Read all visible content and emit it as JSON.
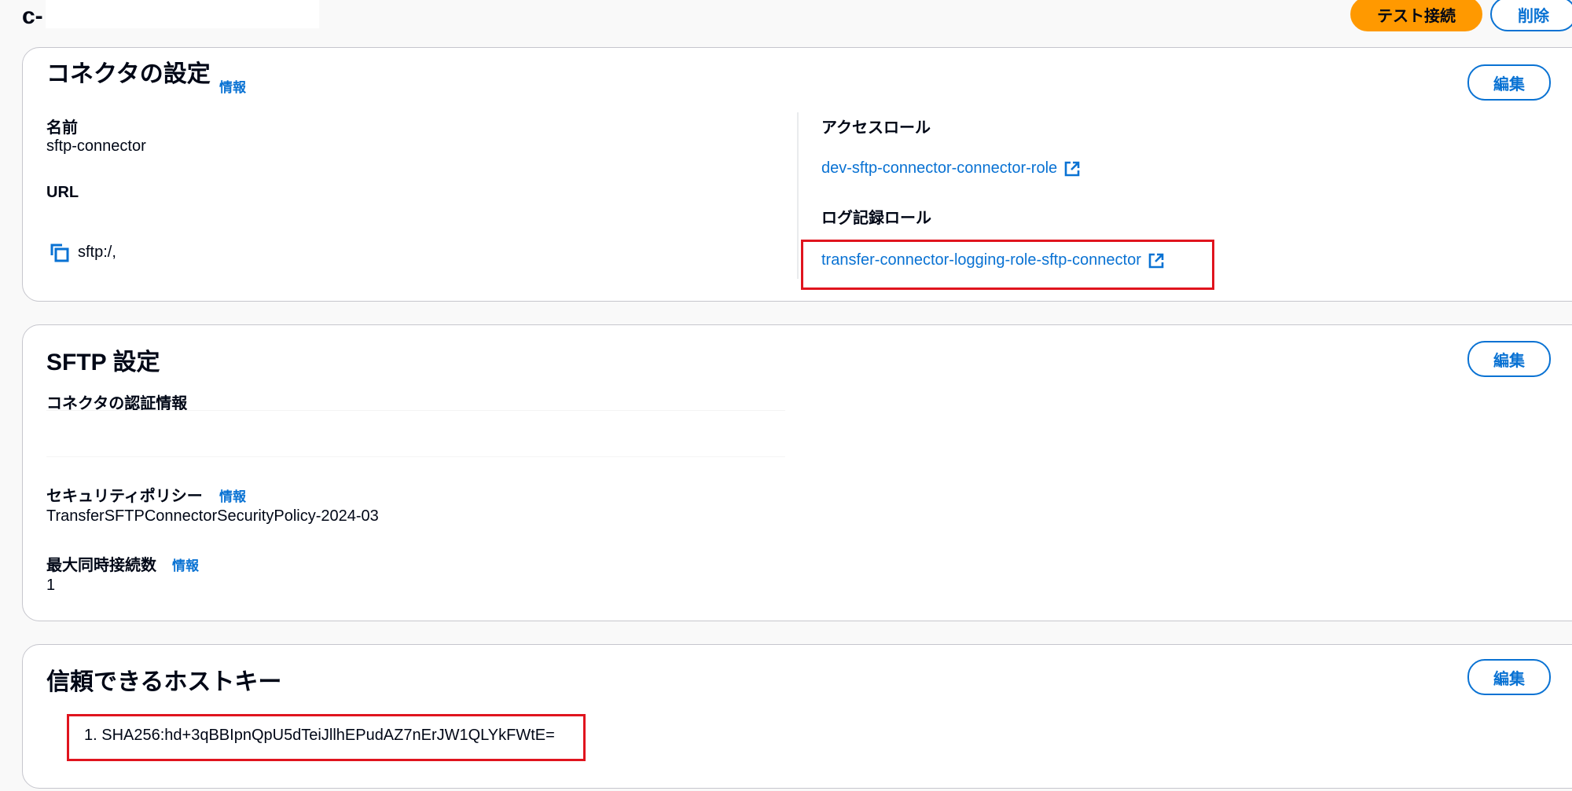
{
  "header": {
    "title": "c-",
    "test_button": "テスト接続",
    "delete_button": "削除"
  },
  "connector_settings": {
    "title": "コネクタの設定",
    "info": "情報",
    "edit": "編集",
    "name_label": "名前",
    "name_value": "sftp-connector",
    "url_label": "URL",
    "url_value": "sftp:/,",
    "access_role_label": "アクセスロール",
    "access_role_link": "dev-sftp-connector-connector-role",
    "logging_role_label": "ログ記録ロール",
    "logging_role_link": "transfer-connector-logging-role-sftp-connector"
  },
  "sftp_settings": {
    "title": "SFTP 設定",
    "edit": "編集",
    "credentials_label": "コネクタの認証情報",
    "security_policy_label": "セキュリティポリシー",
    "security_policy_info": "情報",
    "security_policy_value": "TransferSFTPConnectorSecurityPolicy-2024-03",
    "max_connections_label": "最大同時接続数",
    "max_connections_info": "情報",
    "max_connections_value": "1"
  },
  "trusted_host_keys": {
    "title": "信頼できるホストキー",
    "edit": "編集",
    "keys": [
      "1. SHA256:hd+3qBBIpnQpU5dTeiJllhEPudAZ7nErJW1QLYkFWtE="
    ]
  },
  "colors": {
    "primary": "#ff9900",
    "link": "#0972d3",
    "highlight": "#e0141e"
  },
  "icons": [
    "external-link-icon",
    "copy-icon"
  ]
}
